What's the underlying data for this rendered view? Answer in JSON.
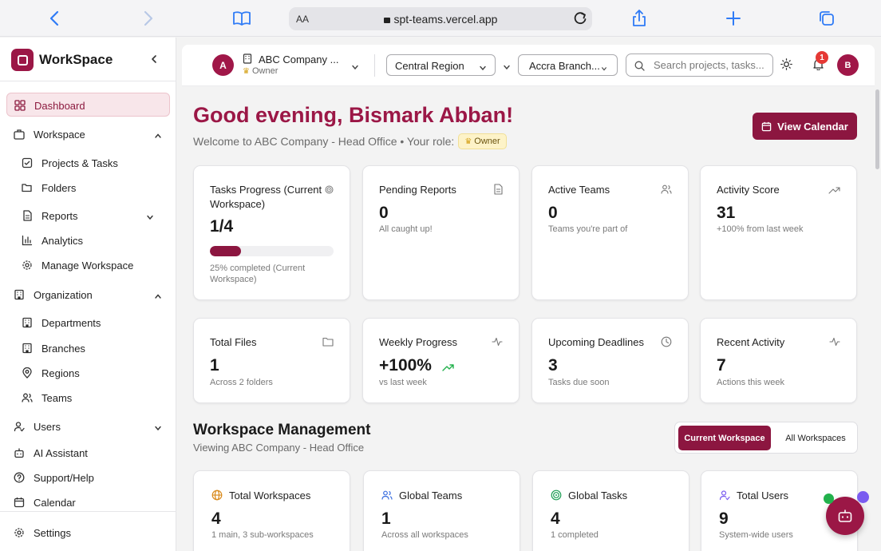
{
  "browser": {
    "text_size_label": "AA",
    "url": "spt-teams.vercel.app"
  },
  "sidebar": {
    "brand": "WorkSpace",
    "items": [
      {
        "label": "Dashboard",
        "icon": "grid-icon",
        "active": true
      },
      {
        "label": "Workspace",
        "icon": "briefcase-icon",
        "expanded": true
      },
      {
        "label": "Projects & Tasks",
        "icon": "check-square-icon",
        "sub": true
      },
      {
        "label": "Folders",
        "icon": "folder-open-icon",
        "sub": true
      },
      {
        "label": "Reports",
        "icon": "file-text-icon",
        "sub": true,
        "collapsed": true
      },
      {
        "label": "Analytics",
        "icon": "bar-chart-icon",
        "sub": true
      },
      {
        "label": "Manage Workspace",
        "icon": "gear-icon",
        "sub": true
      },
      {
        "label": "Organization",
        "icon": "building-icon",
        "expanded": true
      },
      {
        "label": "Departments",
        "icon": "building-icon",
        "sub": true
      },
      {
        "label": "Branches",
        "icon": "building-icon",
        "sub": true
      },
      {
        "label": "Regions",
        "icon": "map-pin-icon",
        "sub": true
      },
      {
        "label": "Teams",
        "icon": "users-icon",
        "sub": true
      },
      {
        "label": "Users",
        "icon": "user-icon",
        "collapsed": true
      },
      {
        "label": "AI Assistant",
        "icon": "bot-icon"
      },
      {
        "label": "Support/Help",
        "icon": "help-circle-icon"
      },
      {
        "label": "Calendar",
        "icon": "calendar-icon"
      },
      {
        "label": "Settings",
        "icon": "gear-icon"
      }
    ]
  },
  "header": {
    "company_initial": "A",
    "company_name": "ABC Company ...",
    "company_role": "Owner",
    "region": "Central Region",
    "branch": "Accra Branch...",
    "search_placeholder": "Search projects, tasks...",
    "notifications_count": "1",
    "user_initial": "B"
  },
  "main": {
    "greeting": "Good evening, Bismark Abban!",
    "welcome": "Welcome to ABC Company - Head Office • Your role:",
    "role": "Owner",
    "calendar_button": "View Calendar",
    "stats_row1": [
      {
        "title": "Tasks Progress (Current Workspace)",
        "value": "1/4",
        "sub": "25% completed (Current Workspace)",
        "icon": "target-icon",
        "progress": 0.25
      },
      {
        "title": "Pending Reports",
        "value": "0",
        "sub": "All caught up!",
        "icon": "file-text-icon"
      },
      {
        "title": "Active Teams",
        "value": "0",
        "sub": "Teams you're part of",
        "icon": "users-icon"
      },
      {
        "title": "Activity Score",
        "value": "31",
        "sub": "+100% from last week",
        "icon": "trending-up-icon"
      }
    ],
    "stats_row2": [
      {
        "title": "Total Files",
        "value": "1",
        "sub": "Across 2 folders",
        "icon": "folder-icon"
      },
      {
        "title": "Weekly Progress",
        "value": "+100%",
        "sub": "vs last week",
        "icon": "activity-icon"
      },
      {
        "title": "Upcoming Deadlines",
        "value": "3",
        "sub": "Tasks due soon",
        "icon": "clock-icon"
      },
      {
        "title": "Recent Activity",
        "value": "7",
        "sub": "Actions this week",
        "icon": "activity-icon"
      }
    ],
    "workspace_mgmt": {
      "title": "Workspace Management",
      "subtitle": "Viewing ABC Company - Head Office",
      "toggle_current": "Current Workspace",
      "toggle_all": "All Workspaces",
      "cards": [
        {
          "title": "Total Workspaces",
          "value": "4",
          "sub": "1 main, 3 sub-workspaces",
          "icon": "globe-icon",
          "color": "#d98a1c"
        },
        {
          "title": "Global Teams",
          "value": "1",
          "sub": "Across all workspaces",
          "icon": "users-icon",
          "color": "#3b6fe0"
        },
        {
          "title": "Global Tasks",
          "value": "4",
          "sub": "1 completed",
          "icon": "target-icon",
          "color": "#1e9e55"
        },
        {
          "title": "Total Users",
          "value": "9",
          "sub": "System-wide users",
          "icon": "user-check-icon",
          "color": "#7a5cf0"
        }
      ]
    }
  },
  "colors": {
    "brand": "#9b1746",
    "brand_dark": "#8c1640",
    "active_bg": "#f8e6ea",
    "badge": "#e53935"
  }
}
